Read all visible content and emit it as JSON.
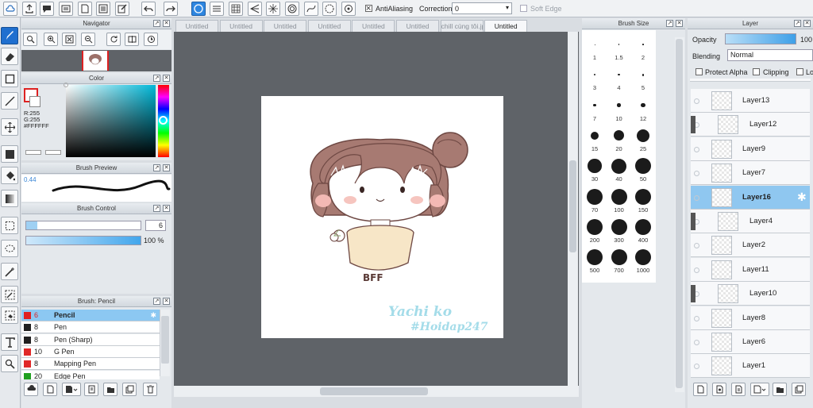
{
  "toolbar": {
    "antialiasing_label": "AntiAliasing",
    "correction_label": "Correction",
    "correction_value": "0",
    "soft_edge_label": "Soft Edge"
  },
  "navigator": {
    "title": "Navigator"
  },
  "color": {
    "title": "Color",
    "r": "R:255",
    "g": "G:255",
    "hex": "#FFFFFF"
  },
  "brush_preview": {
    "title": "Brush Preview",
    "value": "0.44"
  },
  "brush_control": {
    "title": "Brush Control",
    "size": "6",
    "opacity": "100 %"
  },
  "brush_list": {
    "title": "Brush: Pencil",
    "items": [
      {
        "size": "6",
        "name": "Pencil",
        "color": "#e02020",
        "selected": true
      },
      {
        "size": "8",
        "name": "Pen",
        "color": "#202020"
      },
      {
        "size": "8",
        "name": "Pen (Sharp)",
        "color": "#202020"
      },
      {
        "size": "10",
        "name": "G Pen",
        "color": "#e02828"
      },
      {
        "size": "8",
        "name": "Mapping Pen",
        "color": "#e02828"
      },
      {
        "size": "20",
        "name": "Edge Pen",
        "color": "#20a020"
      }
    ]
  },
  "tabs": [
    "Untitled",
    "Untitled",
    "Untitled",
    "Untitled",
    "Untitled",
    "Untitled",
    "chill cùng tôi.jpg",
    "Untitled"
  ],
  "artwork": {
    "shirt_text": "BFF",
    "watermark_line1": "Yachi ko",
    "watermark_line2": "#Hoidap247"
  },
  "brush_size": {
    "title": "Brush Size",
    "sizes": [
      "1",
      "1.5",
      "2",
      "3",
      "4",
      "5",
      "7",
      "10",
      "12",
      "15",
      "20",
      "25",
      "30",
      "40",
      "50",
      "70",
      "100",
      "150",
      "200",
      "300",
      "400",
      "500",
      "700",
      "1000"
    ]
  },
  "layer": {
    "title": "Layer",
    "opacity_label": "Opacity",
    "opacity_value": "100",
    "blending_label": "Blending",
    "blending_value": "Normal",
    "protect_alpha_label": "Protect Alpha",
    "clipping_label": "Clipping",
    "lock_label": "Lo",
    "layers": [
      {
        "name": "Layer13"
      },
      {
        "name": "Layer12",
        "clip": true
      },
      {
        "name": "Layer9"
      },
      {
        "name": "Layer7"
      },
      {
        "name": "Layer16",
        "selected": true
      },
      {
        "name": "Layer4",
        "clip": true
      },
      {
        "name": "Layer2"
      },
      {
        "name": "Layer11"
      },
      {
        "name": "Layer10",
        "clip": true
      },
      {
        "name": "Layer8"
      },
      {
        "name": "Layer6"
      },
      {
        "name": "Layer1"
      }
    ]
  }
}
